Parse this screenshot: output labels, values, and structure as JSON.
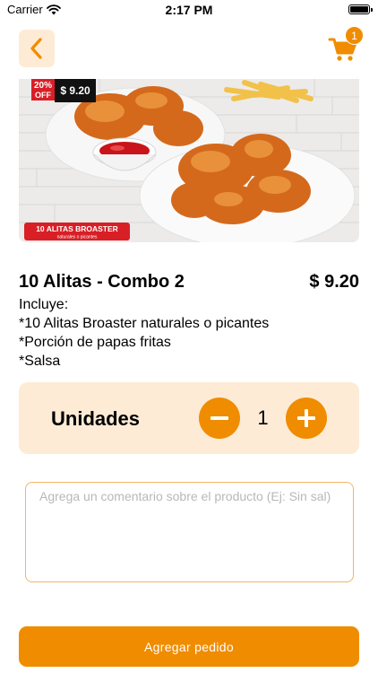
{
  "status_bar": {
    "carrier": "Carrier",
    "time": "2:17 PM"
  },
  "header": {
    "back_icon": "chevron-left-icon",
    "cart_icon": "shopping-cart-icon",
    "cart_count": "1"
  },
  "product_image": {
    "badge_discount_line1": "20%",
    "badge_discount_line2": "OFF",
    "badge_price": "$ 9.20",
    "banner_title": "10 ALITAS BROASTER",
    "banner_subtitle": "naturales o picantes"
  },
  "product": {
    "title": "10 Alitas - Combo 2",
    "price": "$ 9.20",
    "description": [
      "Incluye:",
      "*10 Alitas Broaster naturales o picantes",
      "*Porción de papas fritas",
      "*Salsa"
    ]
  },
  "units": {
    "label": "Unidades",
    "quantity": "1",
    "minus_icon": "minus-icon",
    "plus_icon": "plus-icon"
  },
  "comment": {
    "placeholder": "Agrega un comentario sobre el producto (Ej: Sin sal)",
    "value": ""
  },
  "actions": {
    "add_label": "Agregar pedido"
  },
  "colors": {
    "accent": "#f08c00",
    "accent_light": "#fdebd6",
    "comment_border": "#f3b566"
  }
}
